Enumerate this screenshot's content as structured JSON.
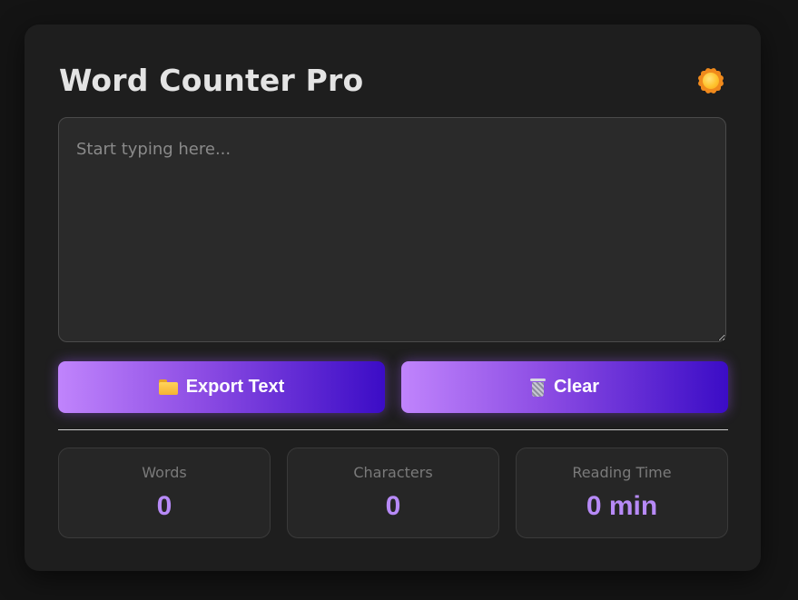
{
  "app": {
    "title": "Word Counter Pro",
    "theme_toggle_icon": "sun-icon"
  },
  "editor": {
    "placeholder": "Start typing here...",
    "value": ""
  },
  "actions": {
    "export_label": "Export Text",
    "export_icon": "folder-icon",
    "clear_label": "Clear",
    "clear_icon": "wastebasket-icon"
  },
  "stats": {
    "words": {
      "label": "Words",
      "value": "0"
    },
    "characters": {
      "label": "Characters",
      "value": "0"
    },
    "reading_time": {
      "label": "Reading Time",
      "value": "0 min"
    }
  },
  "colors": {
    "background": "#141414",
    "card": "#1e1e1e",
    "accent_start": "#c084fc",
    "accent_end": "#3b0cc6",
    "stat_value": "#b78af7"
  }
}
